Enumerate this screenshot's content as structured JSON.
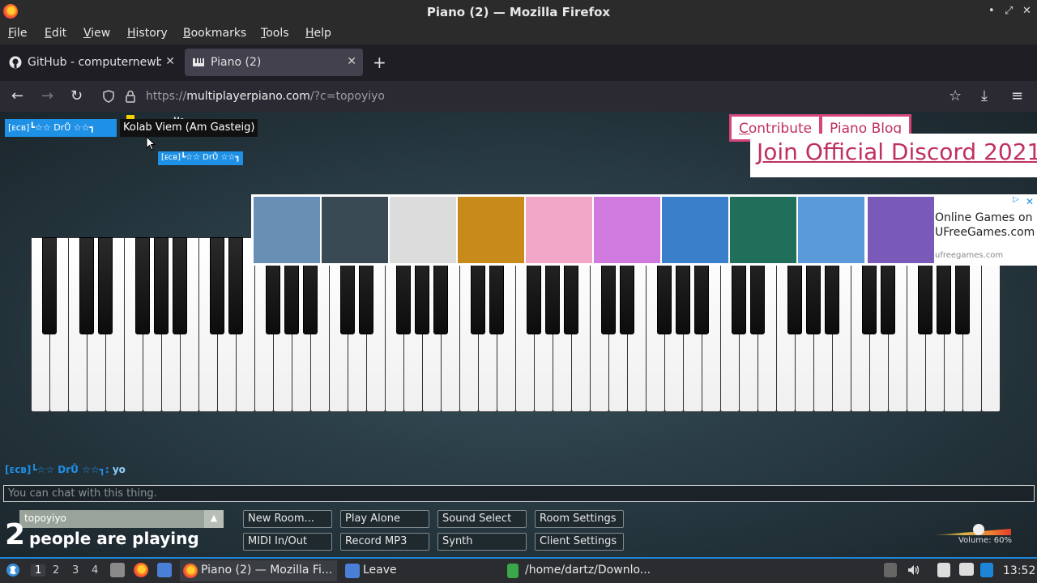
{
  "window": {
    "title": "Piano (2) — Mozilla Firefox",
    "controls": [
      "•",
      "⤢",
      "✕"
    ]
  },
  "menubar": {
    "items": [
      {
        "key": "F",
        "rest": "ile"
      },
      {
        "key": "E",
        "rest": "dit"
      },
      {
        "key": "V",
        "rest": "iew"
      },
      {
        "key": "H",
        "rest": "istory"
      },
      {
        "key": "B",
        "rest": "ookmarks"
      },
      {
        "key": "T",
        "rest": "ools"
      },
      {
        "key": "H",
        "rest": "elp"
      }
    ]
  },
  "tabs": [
    {
      "label": "GitHub - computernewb/",
      "icon": "github-icon"
    },
    {
      "label": "Piano (2)",
      "icon": "piano-icon"
    }
  ],
  "tab_controls": {
    "close": "✕",
    "new_tab": "+"
  },
  "nav": {
    "back": "←",
    "forward": "→",
    "reload": "↻",
    "url_prefix": "https://",
    "url_host": "multiplayerpiano.com",
    "url_path": "/?c=topoyiyo",
    "bookmark": "☆",
    "download": "⤓",
    "menu": "≡"
  },
  "page": {
    "user_tag": "[ᴇᴄʙ]┗☆☆ DrŮ ☆☆┓",
    "owner_tag": "Kolab Viem (Am Gasteig)",
    "me_label": "Me",
    "cursor_tag": "[ᴇᴄʙ]┗☆☆ DrŮ ☆☆┓",
    "links": {
      "contribute": "Contribute",
      "blog": "Piano Blog",
      "discord": "Join Official Discord 2021"
    },
    "ad": {
      "text_line1": "Online Games on",
      "text_line2": "UFreeGames.com",
      "domain": "ufreegames.com",
      "close": "✕",
      "choice": "▷",
      "thumb_colors": [
        "#6a8fb5",
        "#3a4a55",
        "#dcdcdc",
        "#c98a1c",
        "#f2a6c8",
        "#d07adf",
        "#3a7fc9",
        "#1f6f5a",
        "#5a9ad8",
        "#7a5ab8"
      ]
    },
    "chat": {
      "author": "[ᴇᴄʙ]┗☆☆ DrŮ ☆☆┓:",
      "message": "yo",
      "placeholder": "You can chat with this thing."
    },
    "room": {
      "name": "topoyiyo",
      "arrow": "▲"
    },
    "players": {
      "count": "2",
      "label": "people are playing"
    },
    "buttons": [
      "New Room...",
      "Play Alone",
      "Sound Select",
      "Room Settings",
      "MIDI In/Out",
      "Record MP3",
      "Synth",
      "Client Settings"
    ],
    "volume": {
      "label": "Volume: 60%",
      "value": 0.6
    }
  },
  "taskbar": {
    "workspaces": [
      "1",
      "2",
      "3",
      "4"
    ],
    "tasks": [
      "Piano (2) — Mozilla Fi...",
      "Leave",
      "/home/dartz/Downlo..."
    ],
    "clock": "13:52"
  },
  "colors": {
    "accent": "#1e90e6",
    "link_pink": "#c0305e"
  }
}
